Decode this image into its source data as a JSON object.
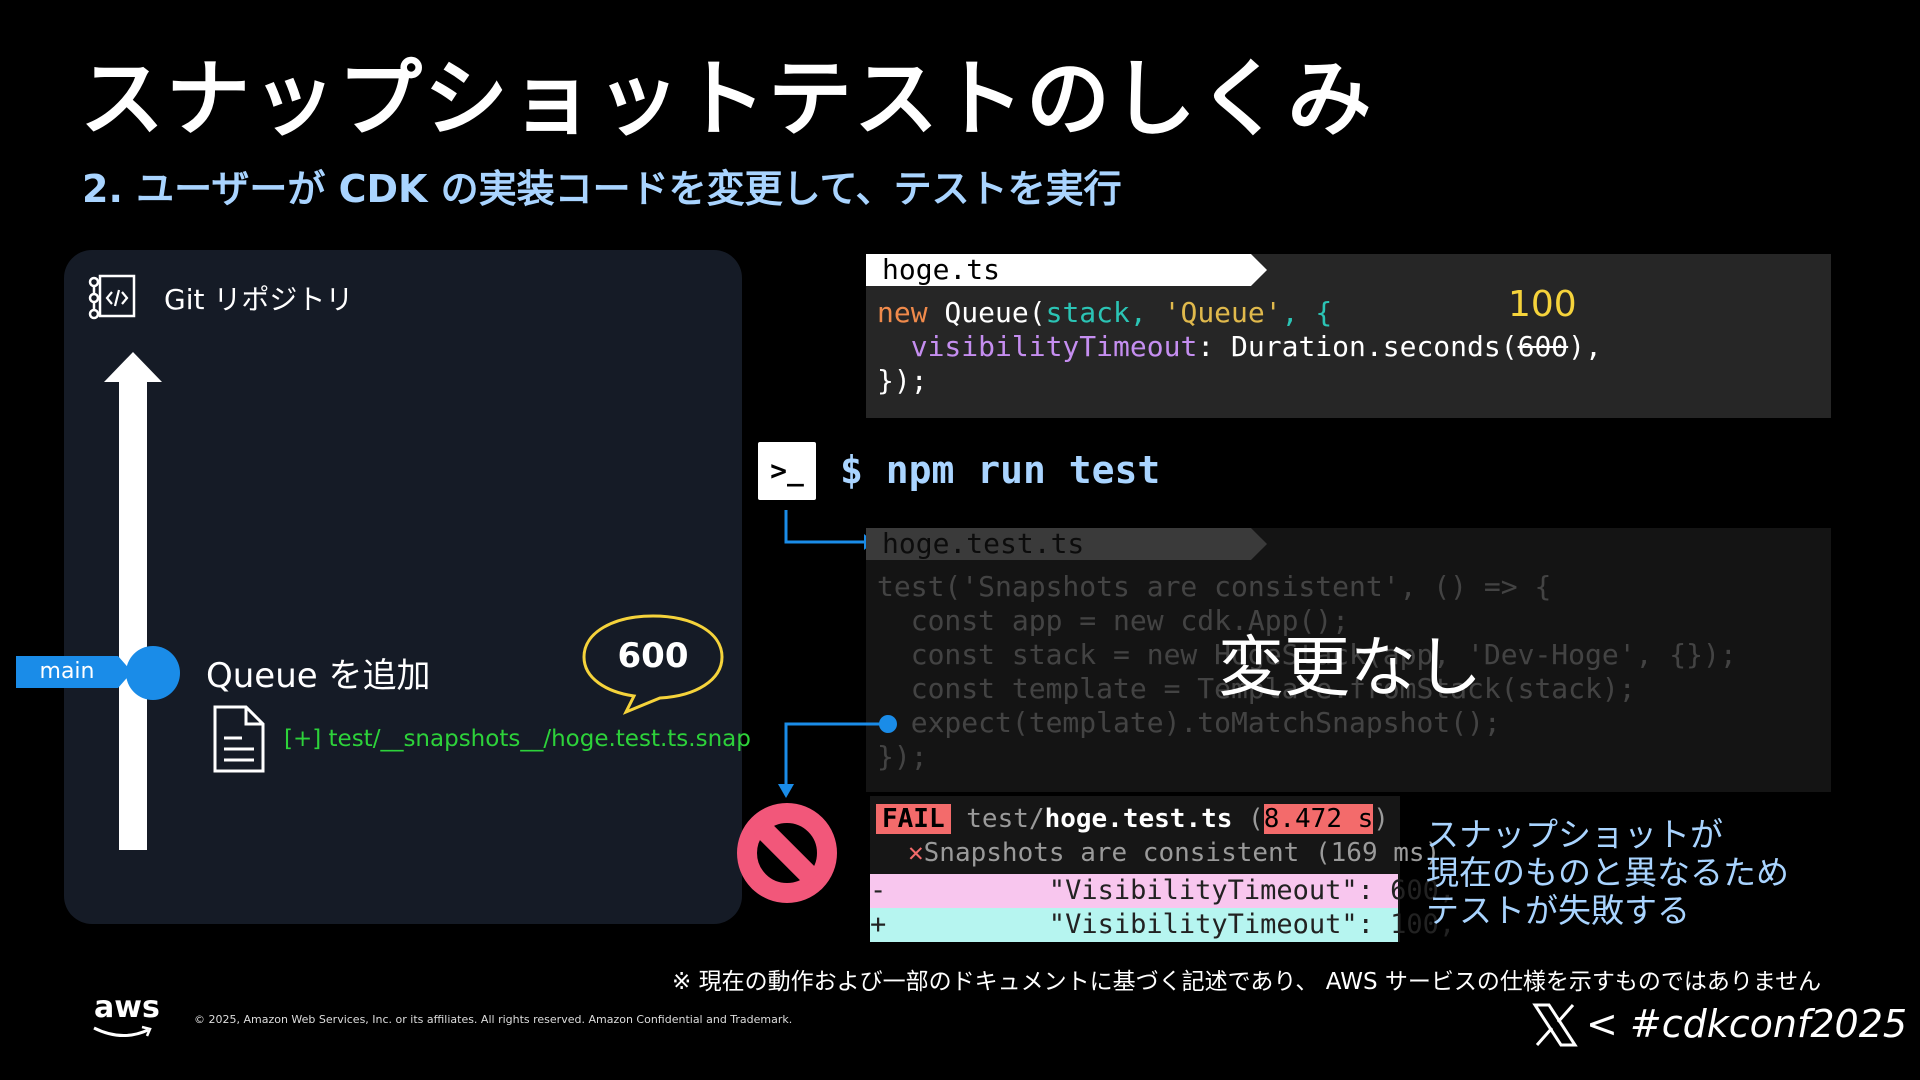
{
  "title": "スナップショットテストのしくみ",
  "subtitle": "2. ユーザーが CDK の実装コードを変更して、テストを実行",
  "git": {
    "label": "Git リポジトリ",
    "branch": "main",
    "commit_label": "Queue を追加",
    "snapshot_file": "[+] test/__snapshots__/hoge.test.ts.snap",
    "bubble_value": "600"
  },
  "code1": {
    "filename": "hoge.ts",
    "line1": {
      "kw": "new",
      "a": " Queue(",
      "b": "stack",
      "c": ", ",
      "d": "'Queue'",
      "e": ", {"
    },
    "line2": {
      "indent": "  ",
      "prop": "visibilityTimeout",
      "a": ": Duration.seconds(",
      "old": "600",
      "b": "),"
    },
    "line3": "});",
    "new_value": "100"
  },
  "terminal": {
    "icon": ">_",
    "command": "$ npm run test"
  },
  "code2": {
    "filename": "hoge.test.ts",
    "lines": [
      "test('Snapshots are consistent', () => {",
      "  const app = new cdk.App();",
      "  const stack = new HogeStack(app, 'Dev-Hoge', {});",
      "  const template = Template.fromStack(stack);",
      "  expect(template).toMatchSnapshot();",
      "});"
    ],
    "overlay": "変更なし"
  },
  "fail": {
    "badge": "FAIL",
    "path_prefix": "test/",
    "path_file": "hoge.test.ts",
    "open": " (",
    "time": "8.472 s",
    "close": ")",
    "x_mark": "✕",
    "case": "Snapshots are consistent (169 ms)",
    "diff_minus": "-          \"VisibilityTimeout\": 600,",
    "diff_plus": "+          \"VisibilityTimeout\": 100,"
  },
  "explain": [
    "スナップショットが",
    "現在のものと異なるため",
    "テストが失敗する"
  ],
  "footnote": "※ 現在の動作および一部のドキュメントに基づく記述であり、 AWS サービスの仕様を示すものではありません",
  "copyright": "© 2025, Amazon Web Services, Inc. or its affiliates. All rights reserved. Amazon Confidential and Trademark.",
  "aws_logo": "aws",
  "hashtag": "< #cdkconf2025",
  "icons": [
    "git-repo-icon",
    "file-icon",
    "terminal-icon",
    "prohibited-icon",
    "x-logo-icon"
  ],
  "colors": {
    "accent": "#1a8ce8",
    "subtitle": "#a9d4ff",
    "fail": "#f36b6b",
    "snapshot_green": "#2dd23a",
    "new_value": "#f5d33b"
  }
}
